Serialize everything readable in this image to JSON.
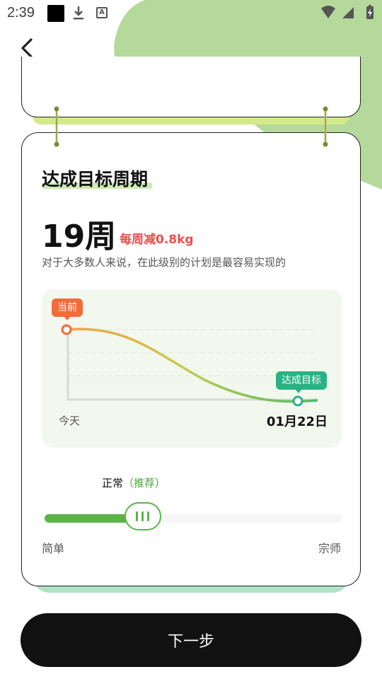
{
  "status_bar": {
    "time": "2:39",
    "icons": [
      "notification-square-icon",
      "download-icon",
      "font-icon",
      "wifi-icon",
      "signal-icon",
      "battery-charging-icon"
    ]
  },
  "nav": {
    "back_icon": "chevron-left-icon"
  },
  "card": {
    "title": "达成目标周期",
    "weeks": "19周",
    "weekly_rate": "每周减0.8kg",
    "description": "对于大多数人来说，在此级别的计划是最容易实现的"
  },
  "chart_data": {
    "type": "line",
    "x_start_label": "今天",
    "x_end_label": "01月22日",
    "start_tag": "当前",
    "end_tag": "达成目标",
    "curve": "smooth-decline",
    "colors": {
      "start": "#f5a04a",
      "mid": "#c9c94a",
      "end": "#4dbb6e"
    }
  },
  "difficulty": {
    "level_text": "正常",
    "recommend_text": "（推荐）",
    "min_label": "简单",
    "max_label": "宗师",
    "value_fraction": 0.33
  },
  "footer": {
    "next_label": "下一步"
  },
  "colors": {
    "accent_green": "#5bb448",
    "blob_green": "#b5d99a",
    "goal_teal": "#29b385",
    "current_orange": "#f26b3a",
    "rate_red": "#ee4d4d",
    "button_black": "#111111"
  }
}
